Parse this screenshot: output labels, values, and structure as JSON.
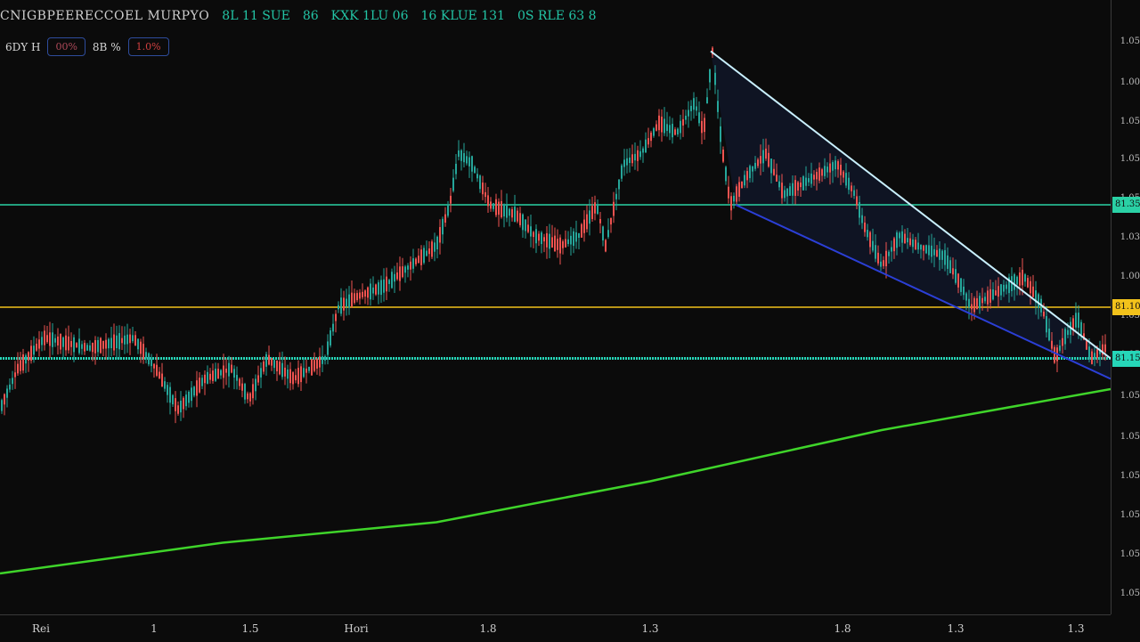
{
  "header": {
    "symbol": "CNIGBPEERECCOEL MURPYO",
    "ohlc": [
      "8L 11 SUE",
      "86",
      "KXK 1LU 06",
      "16 KLUE 131",
      "0S RLE 63 8"
    ],
    "timeframe_label": "6DY H",
    "box_a": "00%",
    "label_b": "8B %",
    "box_b": "1.0%"
  },
  "colors": {
    "bg": "#0b0b0b",
    "up": "#26a69a",
    "down": "#ef5350",
    "resistance": "#2ad1a5",
    "mid_level": "#f2c21b",
    "support": "#26d6b8",
    "ma": "#3fd42a",
    "upper_trend": "#c9f0ff",
    "lower_trend": "#2b3fd6"
  },
  "chart_data": {
    "type": "candlestick",
    "x_tick_labels": [
      "Rei",
      "1",
      "1.5",
      "Hori",
      "1.8",
      "1.3",
      "1.8",
      "1.3",
      "1.3"
    ],
    "y_tick_labels": [
      "1.05",
      "1.00",
      "1.05",
      "1.05",
      "1.05",
      "1.03",
      "1.00",
      "1.05",
      "1.05",
      "1.05",
      "1.05",
      "1.05",
      "1.05",
      "1.05",
      "1.05"
    ],
    "ylim": [
      0.8,
      1.4
    ],
    "horizontal_levels": [
      {
        "value": 1.2,
        "color": "#2ad1a5",
        "badge": "81.35"
      },
      {
        "value": 1.1,
        "color": "#f2c21b",
        "badge": "81.10"
      },
      {
        "value": 1.05,
        "color": "#26d6b8",
        "badge": "81.15"
      }
    ],
    "anchors": [
      [
        0,
        1.0
      ],
      [
        20,
        1.04
      ],
      [
        50,
        1.07
      ],
      [
        100,
        1.06
      ],
      [
        150,
        1.07
      ],
      [
        175,
        1.04
      ],
      [
        200,
        1.0
      ],
      [
        230,
        1.03
      ],
      [
        260,
        1.04
      ],
      [
        280,
        1.01
      ],
      [
        300,
        1.05
      ],
      [
        330,
        1.03
      ],
      [
        365,
        1.05
      ],
      [
        380,
        1.1
      ],
      [
        400,
        1.11
      ],
      [
        430,
        1.12
      ],
      [
        460,
        1.14
      ],
      [
        490,
        1.16
      ],
      [
        505,
        1.2
      ],
      [
        515,
        1.25
      ],
      [
        530,
        1.24
      ],
      [
        550,
        1.2
      ],
      [
        580,
        1.19
      ],
      [
        600,
        1.17
      ],
      [
        630,
        1.16
      ],
      [
        650,
        1.17
      ],
      [
        670,
        1.2
      ],
      [
        680,
        1.16
      ],
      [
        700,
        1.24
      ],
      [
        720,
        1.25
      ],
      [
        740,
        1.28
      ],
      [
        760,
        1.27
      ],
      [
        780,
        1.3
      ],
      [
        790,
        1.27
      ],
      [
        800,
        1.35
      ],
      [
        810,
        1.26
      ],
      [
        820,
        1.2
      ],
      [
        840,
        1.23
      ],
      [
        860,
        1.25
      ],
      [
        880,
        1.21
      ],
      [
        900,
        1.22
      ],
      [
        920,
        1.23
      ],
      [
        940,
        1.24
      ],
      [
        960,
        1.21
      ],
      [
        970,
        1.18
      ],
      [
        990,
        1.14
      ],
      [
        1010,
        1.17
      ],
      [
        1030,
        1.16
      ],
      [
        1060,
        1.15
      ],
      [
        1080,
        1.12
      ],
      [
        1090,
        1.1
      ],
      [
        1110,
        1.11
      ],
      [
        1130,
        1.12
      ],
      [
        1150,
        1.13
      ],
      [
        1170,
        1.1
      ],
      [
        1185,
        1.05
      ],
      [
        1195,
        1.07
      ],
      [
        1210,
        1.09
      ],
      [
        1225,
        1.05
      ],
      [
        1240,
        1.06
      ]
    ],
    "moving_average": [
      [
        0,
        0.84
      ],
      [
        250,
        0.87
      ],
      [
        490,
        0.89
      ],
      [
        730,
        0.93
      ],
      [
        990,
        0.98
      ],
      [
        1247,
        1.02
      ]
    ],
    "trendline_upper": [
      [
        798,
        1.35
      ],
      [
        1247,
        1.05
      ]
    ],
    "trendline_lower": [
      [
        826,
        1.2
      ],
      [
        1247,
        1.03
      ]
    ]
  }
}
